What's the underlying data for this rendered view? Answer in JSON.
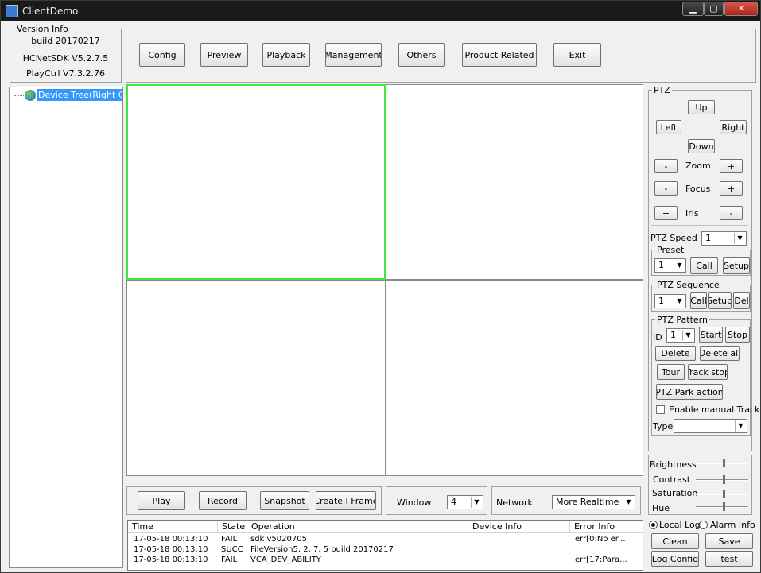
{
  "window": {
    "title": "ClientDemo",
    "min": "▁",
    "max": "▢",
    "close": "✕"
  },
  "version_info": {
    "caption": "Version Info",
    "build": "build 20170217",
    "sdk": "HCNetSDK V5.2.7.5",
    "playctrl": "PlayCtrl V7.3.2.76"
  },
  "menu": {
    "config": "Config",
    "preview": "Preview",
    "playback": "Playback",
    "management": "Management",
    "others": "Others",
    "product_related": "Product Related",
    "exit": "Exit"
  },
  "tree": {
    "root_label": "Device Tree(Right Click"
  },
  "ptz": {
    "caption": "PTZ",
    "up": "Up",
    "left": "Left",
    "right": "Right",
    "down": "Down",
    "zoom": "Zoom",
    "focus": "Focus",
    "iris": "Iris",
    "minus": "-",
    "plus": "+",
    "speed_label": "PTZ Speed",
    "speed_value": "1"
  },
  "preset": {
    "caption": "Preset",
    "value": "1",
    "call": "Call",
    "setup": "Setup"
  },
  "sequence": {
    "caption": "PTZ Sequence",
    "value": "1",
    "call": "Call",
    "setup": "Setup",
    "del": "Del"
  },
  "pattern": {
    "caption": "PTZ Pattern",
    "id_label": "ID",
    "id_value": "1",
    "start": "Start",
    "stop": "Stop",
    "delete": "Delete",
    "delete_all": "Delete all",
    "tour": "Tour",
    "track_stop": "Track stop",
    "park": "PTZ Park action",
    "enable_manual": "Enable manual Track",
    "type_label": "Type",
    "type_value": ""
  },
  "image": {
    "brightness": "Brightness",
    "contrast": "Contrast",
    "saturation": "Saturation",
    "hue": "Hue",
    "brightness_level": 0.55,
    "contrast_level": 0.55,
    "saturation_level": 0.55,
    "hue_level": 0.55
  },
  "controls": {
    "play": "Play",
    "record": "Record",
    "snapshot": "Snapshot",
    "create_iframe": "Create I Frame",
    "window_label": "Window",
    "window_value": "4",
    "network_label": "Network",
    "network_value": "More Realtime"
  },
  "log": {
    "columns": [
      "Time",
      "State",
      "Operation",
      "Device Info",
      "Error Info"
    ],
    "rows": [
      {
        "time": "17-05-18 00:13:10",
        "state": "FAIL",
        "operation": "sdk v5020705",
        "device": "",
        "error": "err[0:No er..."
      },
      {
        "time": "17-05-18 00:13:10",
        "state": "SUCC",
        "operation": "FileVersion5, 2, 7, 5 build 20170217",
        "device": "",
        "error": ""
      },
      {
        "time": "17-05-18 00:13:10",
        "state": "FAIL",
        "operation": "VCA_DEV_ABILITY",
        "device": "",
        "error": "err[17:Para..."
      }
    ]
  },
  "log_options": {
    "local_log": "Local Log",
    "alarm_info": "Alarm Info",
    "clean": "Clean",
    "save": "Save",
    "log_config": "Log Config",
    "test": "test"
  },
  "colors": {
    "selected_pane": "#3ee83e",
    "tree_highlight": "#3399ff"
  }
}
